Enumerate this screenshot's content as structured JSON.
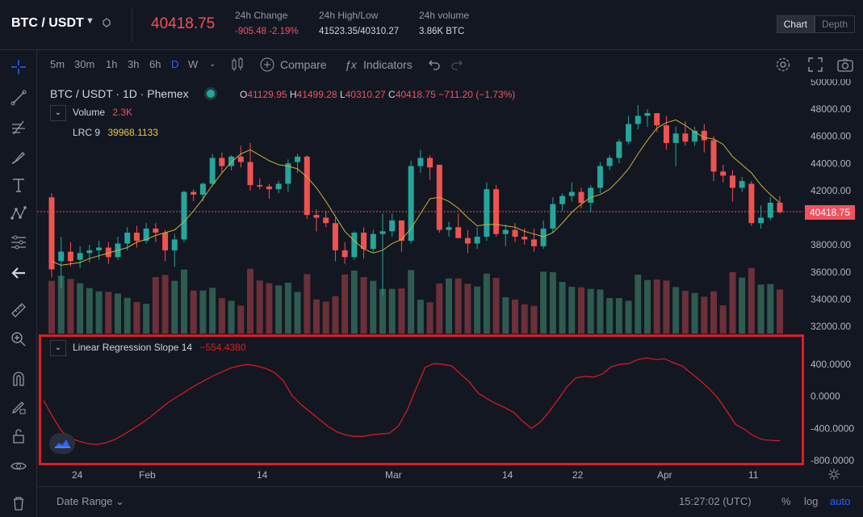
{
  "header": {
    "pair": "BTC / USDT",
    "last_price": "40418.75",
    "change_label": "24h Change",
    "change_value": "-905.48 -2.19%",
    "highlow_label": "24h High/Low",
    "highlow_value": "41523.35/40310.27",
    "volume_label": "24h volume",
    "volume_value": "3.86K BTC",
    "view_chart": "Chart",
    "view_depth": "Depth"
  },
  "toolbar": {
    "timeframes": [
      "5m",
      "30m",
      "1h",
      "3h",
      "6h",
      "D",
      "W"
    ],
    "active_timeframe": "D",
    "compare_label": "Compare",
    "indicators_label": "Indicators"
  },
  "legend": {
    "symbol": "BTC / USDT · 1D · Phemex",
    "open_key": "O",
    "open": "41129.95",
    "high_key": "H",
    "high": "41499.28",
    "low_key": "L",
    "low": "40310.27",
    "close_key": "C",
    "close": "40418.75",
    "change": "−711.20 (−1.73%)",
    "volume_name": "Volume",
    "volume_value": "2.3K",
    "lrc_name": "LRC 9",
    "lrc_value": "39968.1133",
    "lrs_name": "Linear Regression Slope 14",
    "lrs_value": "−554.4380"
  },
  "price_axis": [
    "50000.00",
    "48000.00",
    "46000.00",
    "44000.00",
    "42000.00",
    "38000.00",
    "36000.00",
    "34000.00",
    "32000.00"
  ],
  "current_price_tag": "40418.75",
  "slope_axis": [
    "400.0000",
    "0.0000",
    "-400.0000",
    "-800.0000"
  ],
  "time_axis": [
    "24",
    "Feb",
    "14",
    "Mar",
    "14",
    "22",
    "Apr",
    "11"
  ],
  "footer": {
    "date_range": "Date Range",
    "clock": "15:27:02 (UTC)",
    "percent": "%",
    "log": "log",
    "auto": "auto"
  },
  "colors": {
    "up": "#26a69a",
    "down": "#ef5350",
    "lrc": "#c9b13a",
    "slope": "#e01b24",
    "highlight": "#e01b24"
  },
  "chart_data": {
    "type": "candlestick",
    "ohlc": [
      [
        41500,
        41800,
        35600,
        36200
      ],
      [
        36800,
        38600,
        34800,
        37500
      ],
      [
        37500,
        38200,
        36400,
        36800
      ],
      [
        36900,
        37900,
        36300,
        37400
      ],
      [
        37400,
        38000,
        36700,
        37600
      ],
      [
        37600,
        38300,
        36900,
        37800
      ],
      [
        37800,
        38200,
        36600,
        37100
      ],
      [
        37100,
        38600,
        36900,
        38100
      ],
      [
        38100,
        39300,
        37600,
        38900
      ],
      [
        38900,
        39400,
        37800,
        38300
      ],
      [
        38300,
        39600,
        38100,
        39200
      ],
      [
        39200,
        39600,
        38200,
        38900
      ],
      [
        38900,
        39100,
        36800,
        37600
      ],
      [
        37600,
        38800,
        36400,
        38400
      ],
      [
        38400,
        42000,
        38200,
        41900
      ],
      [
        41900,
        42100,
        41200,
        41700
      ],
      [
        41700,
        42600,
        41200,
        42500
      ],
      [
        42500,
        44700,
        42300,
        44400
      ],
      [
        44400,
        44800,
        43300,
        43800
      ],
      [
        43800,
        44600,
        43500,
        44500
      ],
      [
        44500,
        45300,
        43700,
        44100
      ],
      [
        44100,
        45500,
        42000,
        42400
      ],
      [
        42400,
        42900,
        42100,
        42300
      ],
      [
        42300,
        42500,
        41400,
        42100
      ],
      [
        42100,
        42700,
        41800,
        42500
      ],
      [
        42500,
        44300,
        41900,
        44000
      ],
      [
        44100,
        44700,
        43300,
        44500
      ],
      [
        44500,
        44600,
        39900,
        40200
      ],
      [
        40200,
        40600,
        39000,
        40000
      ],
      [
        40000,
        40500,
        39300,
        39600
      ],
      [
        39600,
        40000,
        36800,
        37600
      ],
      [
        37600,
        38200,
        36600,
        37100
      ],
      [
        37100,
        39000,
        36900,
        38900
      ],
      [
        38900,
        39300,
        37000,
        37700
      ],
      [
        37700,
        39100,
        37500,
        38800
      ],
      [
        38800,
        40300,
        34300,
        39000
      ],
      [
        39000,
        40300,
        38600,
        39800
      ],
      [
        39800,
        39700,
        37500,
        38300
      ],
      [
        38300,
        44200,
        38100,
        43800
      ],
      [
        43800,
        45000,
        43300,
        44400
      ],
      [
        44400,
        44600,
        42800,
        43700
      ],
      [
        43900,
        43900,
        38900,
        39100
      ],
      [
        39100,
        39700,
        38600,
        39300
      ],
      [
        39300,
        40300,
        38500,
        38500
      ],
      [
        38500,
        39100,
        37400,
        38100
      ],
      [
        38100,
        39300,
        37700,
        38600
      ],
      [
        38600,
        42600,
        38300,
        42100
      ],
      [
        42100,
        42400,
        38600,
        38800
      ],
      [
        38800,
        39500,
        37900,
        39100
      ],
      [
        39100,
        39600,
        38200,
        38600
      ],
      [
        38600,
        39200,
        38000,
        38400
      ],
      [
        38400,
        39200,
        37500,
        37900
      ],
      [
        37900,
        39800,
        37700,
        39200
      ],
      [
        39200,
        41500,
        38900,
        41000
      ],
      [
        41000,
        41800,
        40500,
        41600
      ],
      [
        41600,
        42600,
        41200,
        41900
      ],
      [
        41900,
        42200,
        40700,
        41100
      ],
      [
        41100,
        42400,
        40400,
        42200
      ],
      [
        42200,
        44100,
        41800,
        43800
      ],
      [
        43800,
        44600,
        43500,
        44400
      ],
      [
        44400,
        45800,
        44000,
        45600
      ],
      [
        45600,
        47500,
        45400,
        46900
      ],
      [
        46900,
        48300,
        46500,
        47500
      ],
      [
        47500,
        48000,
        46700,
        47700
      ],
      [
        47700,
        47700,
        46300,
        46800
      ],
      [
        46800,
        47500,
        45000,
        45500
      ],
      [
        45500,
        46700,
        43800,
        46200
      ],
      [
        46200,
        47100,
        45300,
        45600
      ],
      [
        45600,
        46700,
        45300,
        46400
      ],
      [
        46400,
        46900,
        44800,
        45700
      ],
      [
        45700,
        46000,
        42700,
        43400
      ],
      [
        43400,
        43900,
        42600,
        43100
      ],
      [
        43100,
        43500,
        41200,
        42200
      ],
      [
        42200,
        43000,
        41900,
        42700
      ],
      [
        42500,
        42700,
        39400,
        39600
      ],
      [
        39600,
        40900,
        39200,
        40000
      ],
      [
        40000,
        41500,
        39800,
        41100
      ],
      [
        41100,
        41600,
        40300,
        40400
      ]
    ],
    "lrc_9": [
      36800,
      36500,
      36600,
      36700,
      37000,
      37200,
      37400,
      37600,
      37800,
      38200,
      38400,
      38700,
      38900,
      39100,
      39700,
      40500,
      41400,
      42400,
      43300,
      44100,
      44700,
      45000,
      44600,
      44200,
      43900,
      43800,
      43600,
      43000,
      42200,
      41200,
      40100,
      39000,
      38300,
      37700,
      37400,
      37600,
      38100,
      38400,
      39200,
      40300,
      41400,
      41500,
      41200,
      40700,
      40000,
      39400,
      39500,
      39500,
      39400,
      39300,
      39000,
      38800,
      38600,
      38900,
      39600,
      40400,
      41000,
      41500,
      41700,
      42100,
      42800,
      43600,
      44700,
      45700,
      46600,
      47000,
      47200,
      46800,
      46300,
      45900,
      45800,
      45400,
      44500,
      43900,
      43300,
      42400,
      41700,
      41100
    ],
    "lrs_14": [
      -50,
      -250,
      -430,
      -520,
      -560,
      -590,
      -600,
      -580,
      -540,
      -480,
      -410,
      -340,
      -260,
      -170,
      -80,
      -10,
      60,
      130,
      190,
      250,
      300,
      350,
      380,
      400,
      380,
      350,
      300,
      200,
      10,
      -100,
      -190,
      -280,
      -370,
      -440,
      -480,
      -500,
      -500,
      -480,
      -470,
      -460,
      -370,
      -170,
      100,
      360,
      410,
      400,
      380,
      280,
      180,
      40,
      -30,
      -90,
      -140,
      -200,
      -310,
      -400,
      -320,
      -190,
      -40,
      120,
      230,
      250,
      240,
      280,
      370,
      400,
      410,
      460,
      480,
      460,
      470,
      420,
      380,
      290,
      200,
      100,
      -20,
      -180,
      -350,
      -410,
      -490,
      -540,
      -550,
      -554
    ]
  }
}
